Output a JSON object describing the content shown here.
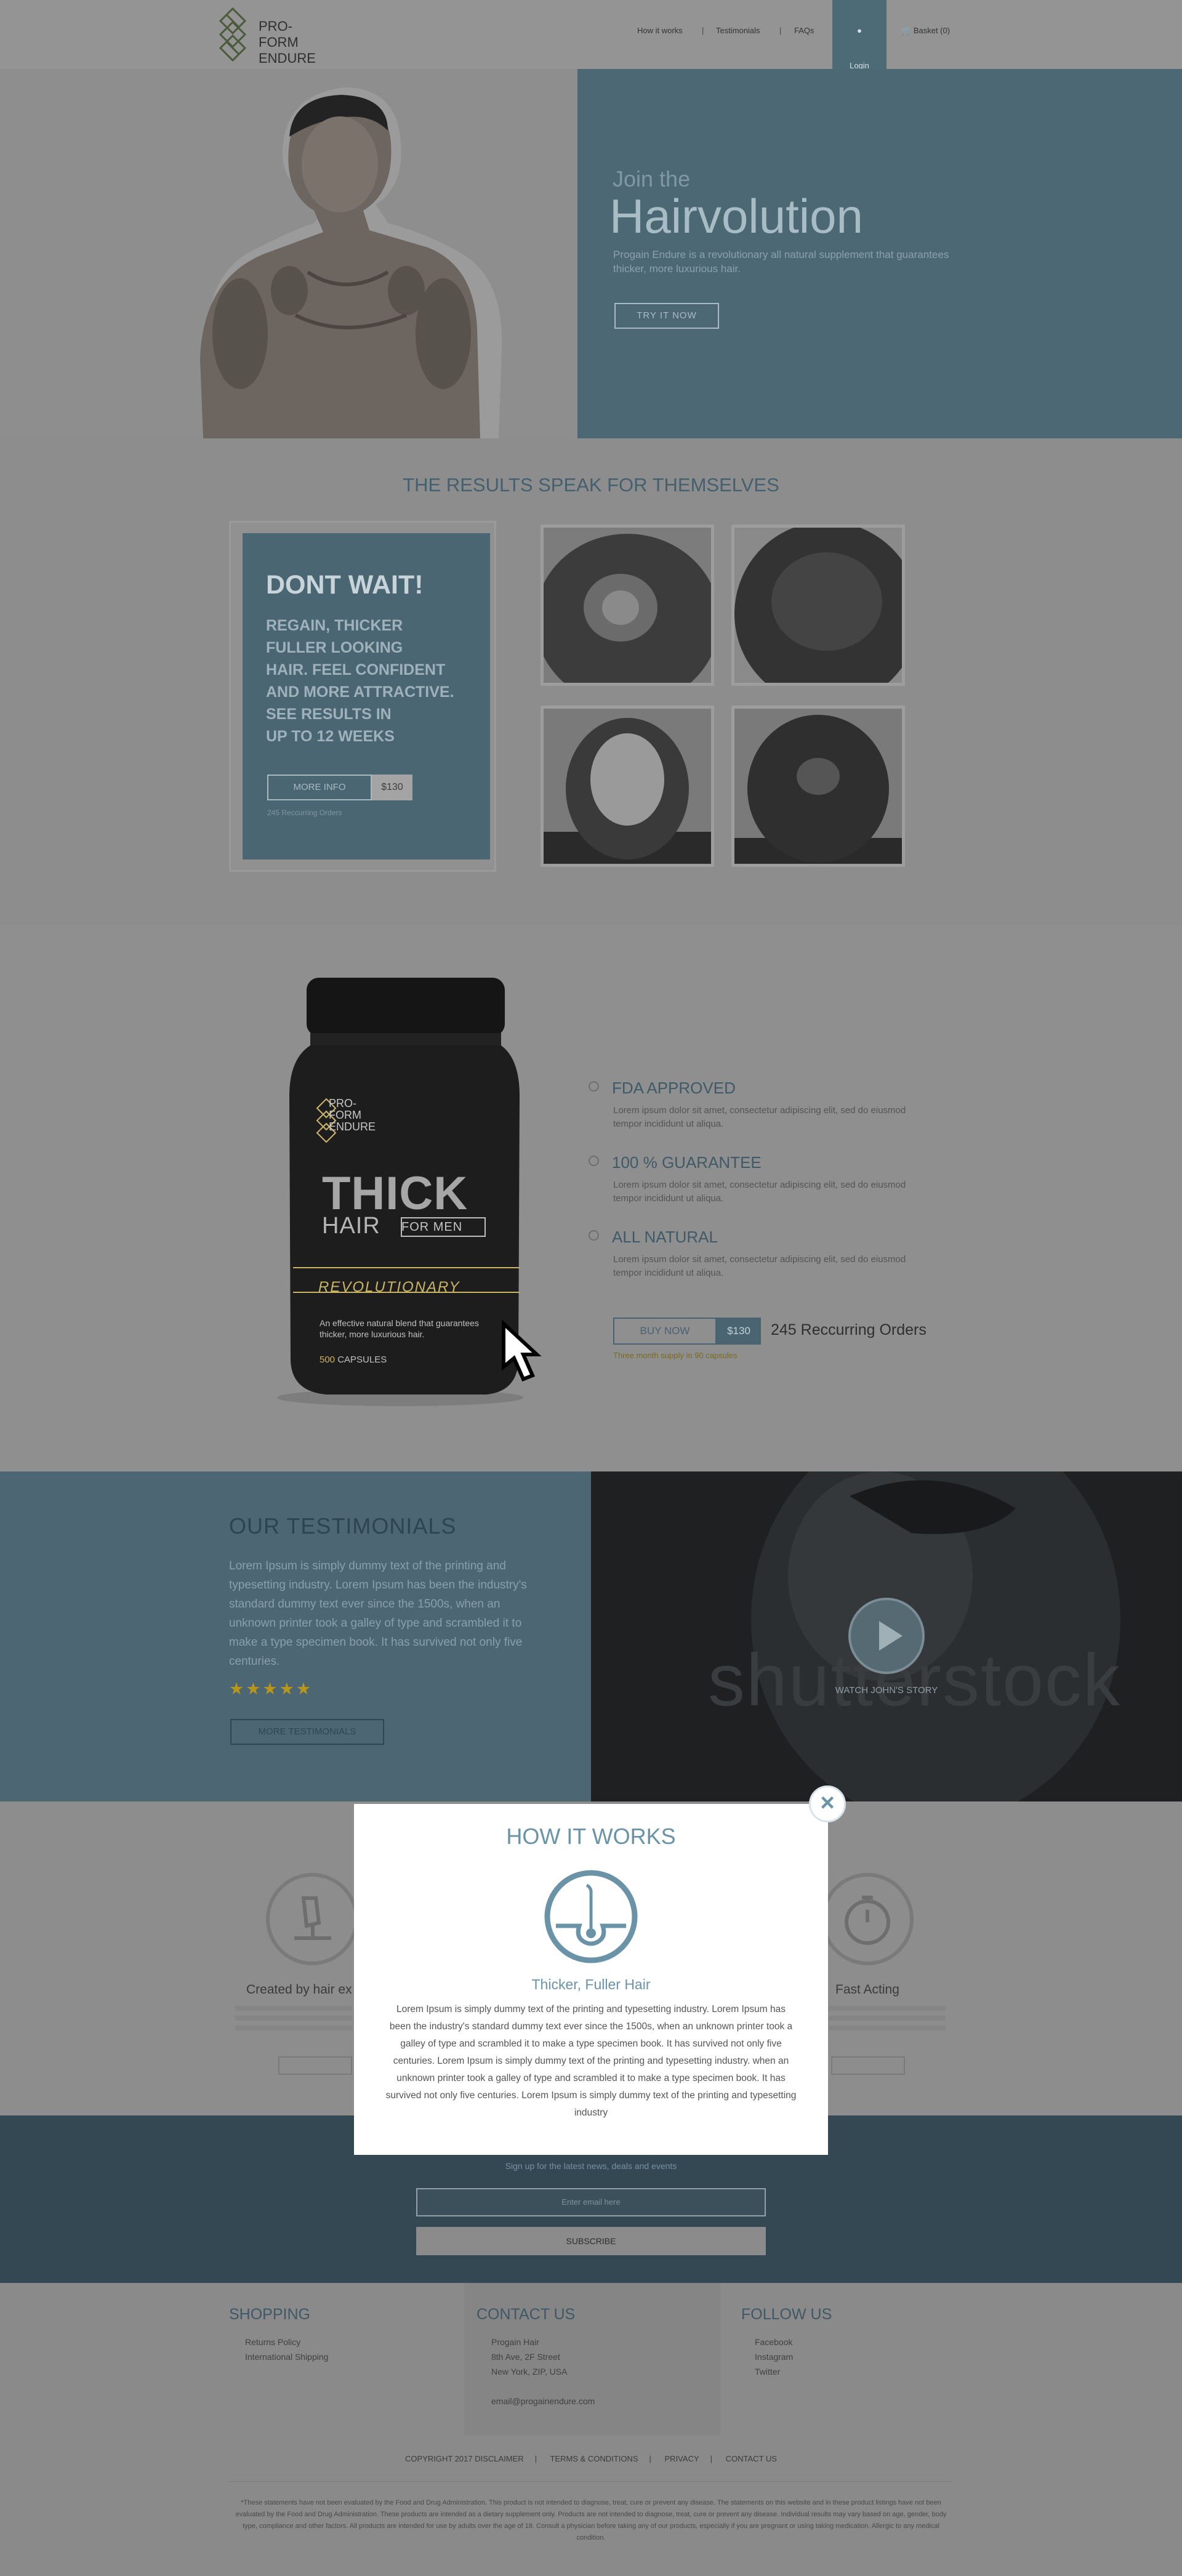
{
  "colors": {
    "accent": "#6a93a8",
    "brand_dark": "#4d6875",
    "star": "#b7961a",
    "overlay": "#8a8a8a"
  },
  "header": {
    "logo_line1": "PRO-",
    "logo_line2": "FORM",
    "logo_line3": "ENDURE",
    "nav": [
      "How it works",
      "Testimonials",
      "FAQs"
    ],
    "login": "Login",
    "basket": "Basket (0)"
  },
  "hero": {
    "join": "Join the",
    "title": "Hairvolution",
    "desc": "Progain Endure is a revolutionary all natural supplement that guarantees thicker, more luxurious hair.",
    "cta": "TRY IT NOW"
  },
  "results": {
    "title": "THE RESULTS SPEAK FOR THEMSELVES",
    "promo_head": "DONT WAIT!",
    "promo_lines": [
      "REGAIN, THICKER",
      "FULLER LOOKING",
      "HAIR. FEEL CONFIDENT",
      "AND MORE ATTRACTIVE.",
      "SEE RESULTS IN",
      "UP TO 12 WEEKS"
    ],
    "more_info": "MORE INFO",
    "price": "$130",
    "orders": "245 Reccurring Orders"
  },
  "product": {
    "bottle_brand1": "PRO-",
    "bottle_brand2": "FORM",
    "bottle_brand3": "ENDURE",
    "bottle_thick": "THICK",
    "bottle_hair": "HAIR",
    "bottle_formen": "FOR MEN",
    "bottle_revolutionary": "REVOLUTIONARY",
    "bottle_blend": "An effective natural blend that guarantees thicker, more luxurious hair.",
    "bottle_caps_num": "500",
    "bottle_caps": "CAPSULES",
    "features": [
      {
        "title": "FDA APPROVED",
        "desc": "Lorem ipsum dolor sit amet, consectetur adipiscing elit, sed do eiusmod tempor incididunt ut aliqua."
      },
      {
        "title": "100 % GUARANTEE",
        "desc": "Lorem ipsum dolor sit amet, consectetur adipiscing elit, sed do eiusmod tempor incididunt ut aliqua."
      },
      {
        "title": "ALL NATURAL",
        "desc": "Lorem ipsum dolor sit amet, consectetur adipiscing elit, sed do eiusmod tempor incididunt ut aliqua."
      }
    ],
    "buy": "BUY NOW",
    "price": "$130",
    "orders": "245 Reccurring Orders",
    "note": "Three month supply in 90 capsules"
  },
  "testimonials": {
    "title": "OUR  TESTIMONIALS",
    "text": "Lorem Ipsum is simply dummy text of the printing and typesetting industry. Lorem Ipsum has been the industry's standard dummy text ever since the 1500s, when an unknown printer took a galley of type and scrambled it to make a type specimen book. It has survived not only five centuries.",
    "stars": "★★★★★",
    "more": "MORE TESTIMONIALS",
    "watermark": "shutterstock",
    "watch": "WATCH JOHN'S STORY"
  },
  "how_bg": {
    "left_title": "Created by hair ex",
    "right_title": "Fast Acting"
  },
  "subscribe": {
    "text": "Sign up for the latest news, deals and events",
    "placeholder": "Enter email here",
    "button": "SUBSCRIBE"
  },
  "footer": {
    "shopping_title": "SHOPPING",
    "shopping": [
      "Returns Policy",
      "International Shipping"
    ],
    "contact_title": "CONTACT US",
    "contact": [
      "Progain Hair",
      "8th Ave, 2F Street",
      "New York, ZIP, USA"
    ],
    "email": "email@progainendure.com",
    "follow_title": "FOLLOW US",
    "follow": [
      "Facebook",
      "Instagram",
      "Twitter"
    ],
    "links": [
      "COPYRIGHT 2017 DISCLAIMER",
      "TERMS & CONDITIONS",
      "PRIVACY",
      "CONTACT US"
    ],
    "disclaimer": "*These statements have not been evaluated by the Food and Drug Administration. This product is not intended to diagnose, treat, cure or prevent any disease. The statements on this website and in these product listings have not been evaluated by the Food and Drug Administration. These products are intended as a dietary supplement only. Products are not intended to diagnose, treat, cure or prevent any disease. Individual results may vary based on age, gender, body type, compliance and other factors. All products are intended for use by adults over the age of 18. Consult a physician before taking any of our products, especially if you are pregnant or using taking medication. Allergic to any medical condition."
  },
  "modal": {
    "title": "HOW IT WORKS",
    "subtitle": "Thicker, Fuller Hair",
    "text": "Lorem Ipsum is simply dummy text of the printing and typesetting industry. Lorem Ipsum has been the industry's standard dummy text ever since the 1500s, when an unknown printer took a galley of type and scrambled it to make a type specimen book. It has survived not only five centuries. Lorem Ipsum is simply dummy text of the printing and typesetting industry. when an unknown printer took a galley of type and scrambled it to make a type specimen book. It has survived not only five centuries. Lorem Ipsum is simply dummy text of the printing and typesetting industry",
    "close": "×"
  }
}
